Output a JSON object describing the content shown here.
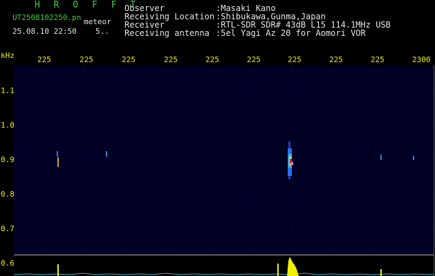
{
  "header": {
    "brand": "H R O F F T",
    "filename": "UT2508102250.pn",
    "meteor_tag": "meteor",
    "datetime": "25.08.10 22:50",
    "count": "5.."
  },
  "info": [
    {
      "label": "Observer",
      "value": ":Masaki Kano"
    },
    {
      "label": "Receiving Location",
      "value": ":Shibukawa,Gunma,Japan"
    },
    {
      "label": "Receiver",
      "value": ":RTL-SDR SDR# 43dB L15 114.1MHz USB"
    },
    {
      "label": "Receiving antenna",
      "value": ":5el Yagi Az 20 for Aomori VOR"
    }
  ],
  "axes": {
    "y_unit": "kHz",
    "y_ticks": [
      "1.1",
      "1.0",
      "0.9",
      "0.8",
      "0.7",
      "0.6"
    ],
    "x_ticks": [
      "225",
      "225",
      "225",
      "225",
      "225",
      "225",
      "225",
      "225",
      "225",
      "2300"
    ]
  },
  "colors": {
    "background": "#000000",
    "plot_background": "#000024",
    "text_green": "#3cd13c",
    "text_white": "#e6e6e6",
    "axis_yellow": "#f0f000"
  }
}
